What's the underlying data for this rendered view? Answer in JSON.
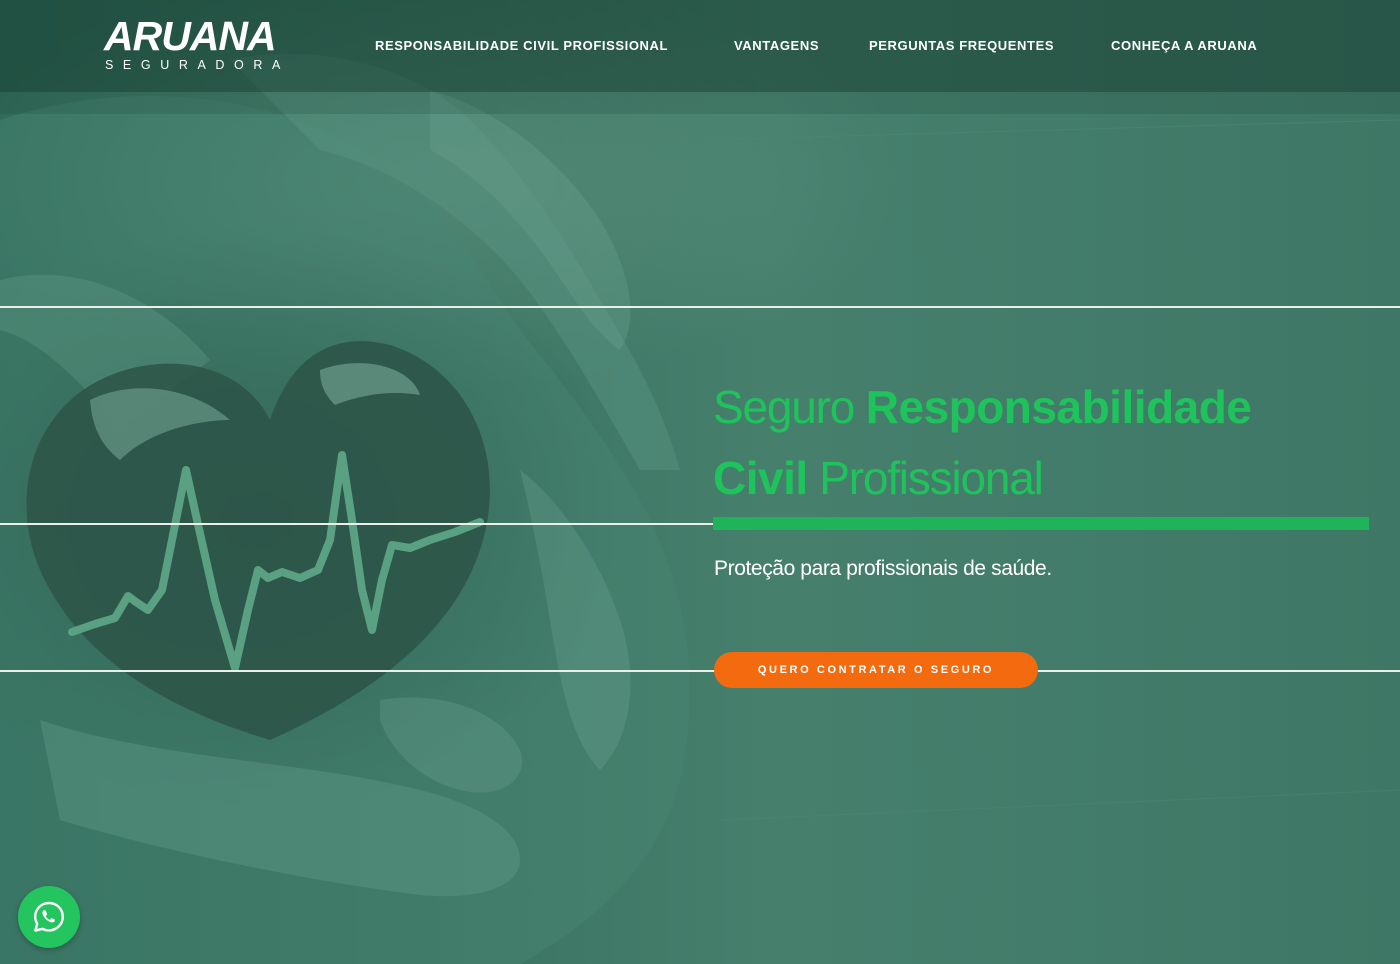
{
  "brand": {
    "logo_word": "ARUANA",
    "logo_sub": "SEGURADORA"
  },
  "nav": {
    "items": [
      {
        "label": "RESPONSABILIDADE CIVIL PROFISSIONAL"
      },
      {
        "label": "VANTAGENS"
      },
      {
        "label": "PERGUNTAS FREQUENTES"
      },
      {
        "label": "CONHEÇA A ARUANA"
      }
    ]
  },
  "hero": {
    "title_part1": "Seguro ",
    "title_part2": "Responsabilidade",
    "title_part3": "Civil",
    "title_part4": " Profissional",
    "subtitle": "Proteção para profissionais de saúde.",
    "cta_label": "QUERO CONTRATAR O SEGURO"
  },
  "floating": {
    "whatsapp_icon": "whatsapp-icon"
  },
  "colors": {
    "accent_green": "#1fc35c",
    "bar_green": "#1fb45a",
    "cta_orange": "#f46a0e",
    "background": "#3f7766",
    "whatsapp": "#24c45f"
  }
}
